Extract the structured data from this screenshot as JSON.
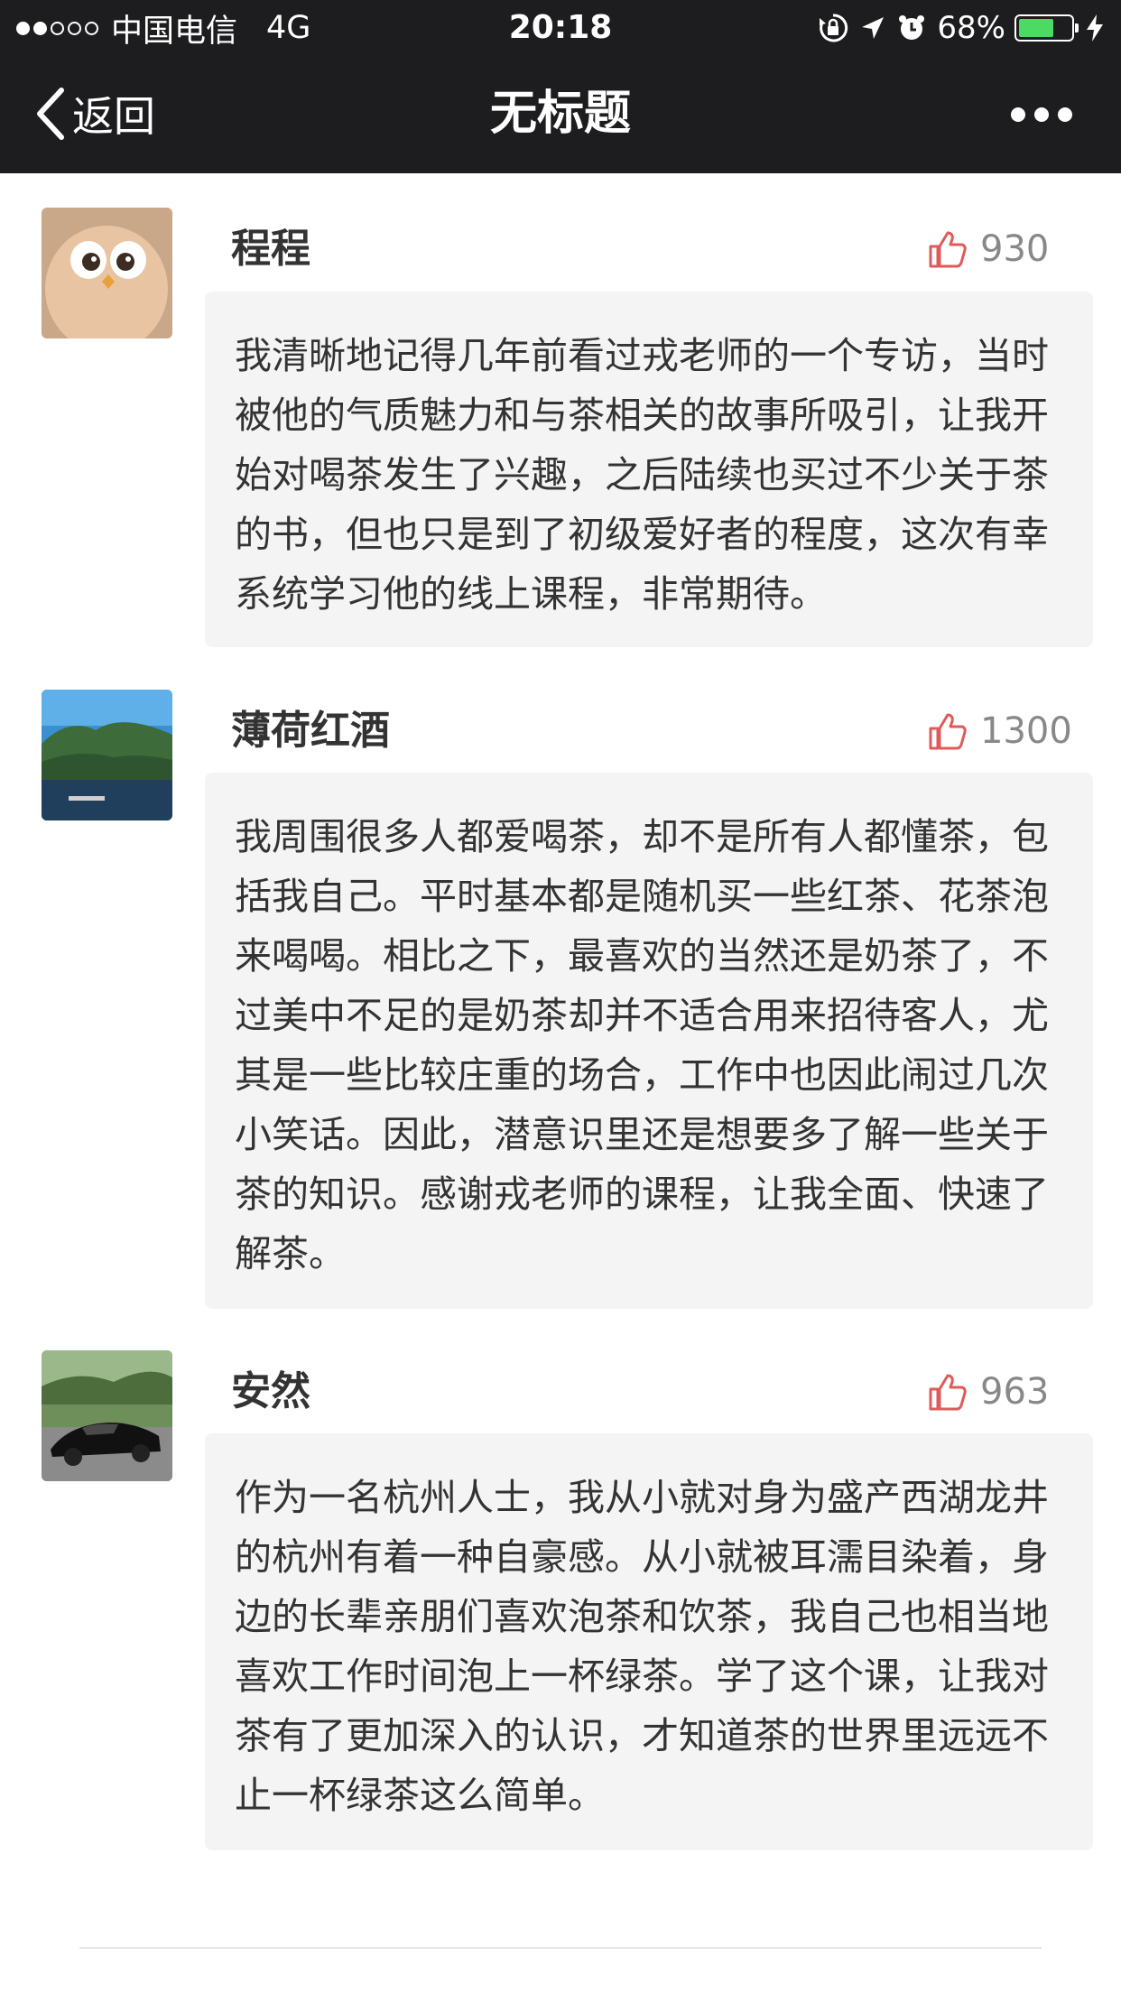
{
  "status_bar": {
    "carrier": "中国电信",
    "network": "4G",
    "time": "20:18",
    "battery": "68%",
    "signal_bars_filled": 2,
    "signal_bars_total": 5
  },
  "nav": {
    "back_label": "返回",
    "title": "无标题"
  },
  "comments": [
    {
      "name": "程程",
      "likes": "930",
      "text": "我清晰地记得几年前看过戎老师的一个专访，当时被他的气质魅力和与茶相关的故事所吸引，让我开始对喝茶发生了兴趣，之后陆续也买过不少关于茶的书，但也只是到了初级爱好者的程度，这次有幸系统学习他的线上课程，非常期待。"
    },
    {
      "name": "薄荷红酒",
      "likes": "1300",
      "text": "我周围很多人都爱喝茶，却不是所有人都懂茶，包括我自己。平时基本都是随机买一些红茶、花茶泡来喝喝。相比之下，最喜欢的当然还是奶茶了，不过美中不足的是奶茶却并不适合用来招待客人，尤其是一些比较庄重的场合，工作中也因此闹过几次小笑话。因此，潜意识里还是想要多了解一些关于茶的知识。感谢戎老师的课程，让我全面、快速了解茶。"
    },
    {
      "name": "安然",
      "likes": "963",
      "text": "作为一名杭州人士，我从小就对身为盛产西湖龙井的杭州有着一种自豪感。从小就被耳濡目染着，身边的长辈亲朋们喜欢泡茶和饮茶，我自己也相当地喜欢工作时间泡上一杯绿茶。学了这个课，让我对茶有了更加深入的认识，才知道茶的世界里远远不止一杯绿茶这么简单。"
    }
  ],
  "colors": {
    "bar_background": "#1d1d1f",
    "like_icon": "#e05a5a",
    "bubble_background": "#f4f4f4",
    "battery_fill": "#4cd964"
  },
  "icons": {
    "back": "chevron-left-icon",
    "more": "more-dots-icon",
    "like": "thumbs-up-icon",
    "lock": "rotation-lock-icon",
    "location": "location-arrow-icon",
    "alarm": "alarm-clock-icon",
    "charging": "charging-bolt-icon"
  }
}
